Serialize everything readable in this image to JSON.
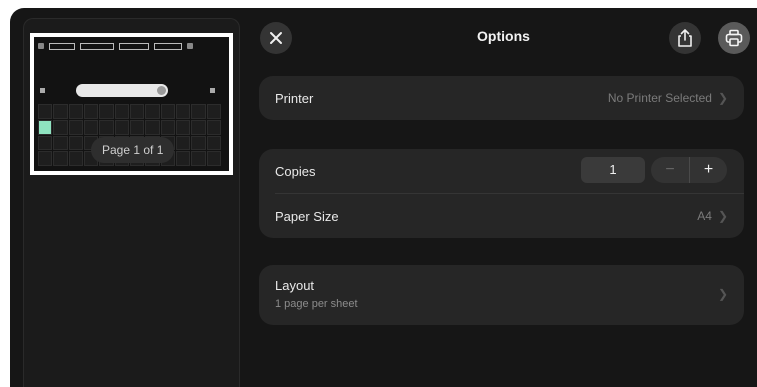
{
  "preview": {
    "page_indicator": "Page 1 of 1"
  },
  "header": {
    "title": "Options",
    "close_icon": "close-icon",
    "share_icon": "share-icon",
    "print_icon": "printer-icon"
  },
  "printer": {
    "label": "Printer",
    "value": "No Printer Selected"
  },
  "copies": {
    "label": "Copies",
    "value": "1",
    "minus": "−",
    "plus": "+"
  },
  "paper_size": {
    "label": "Paper Size",
    "value": "A4"
  },
  "layout": {
    "label": "Layout",
    "value": "1 page per sheet"
  },
  "colors": {
    "background": "#161616",
    "card": "#262626",
    "accent_cell": "#8fe3c0"
  }
}
